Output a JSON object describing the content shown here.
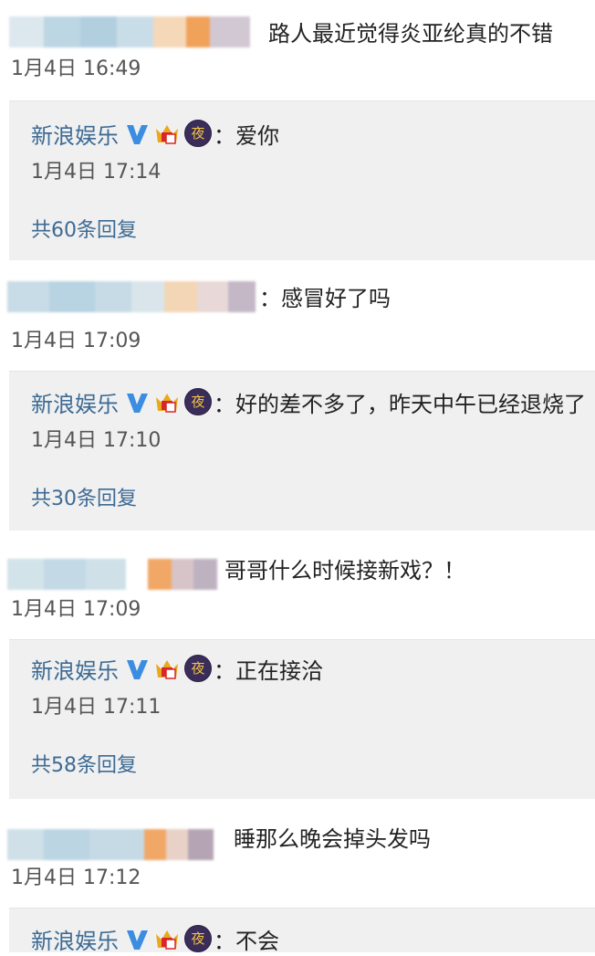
{
  "comments": [
    {
      "text": "路人最近觉得炎亚纶真的不错",
      "time": "1月4日 16:49",
      "reply": {
        "name": "新浪娱乐",
        "text": "：爱你",
        "time": "1月4日 17:14",
        "count": "共60条回复"
      }
    },
    {
      "text": "：感冒好了吗",
      "time": "1月4日 17:09",
      "reply": {
        "name": "新浪娱乐",
        "text": "：好的差不多了，昨天中午已经退烧了",
        "time": "1月4日 17:10",
        "count": "共30条回复"
      }
    },
    {
      "text": "哥哥什么时候接新戏？！",
      "time": "1月4日 17:09",
      "reply": {
        "name": "新浪娱乐",
        "text": "：正在接洽",
        "time": "1月4日 17:11",
        "count": "共58条回复"
      }
    },
    {
      "text": "睡那么晚会掉头发吗",
      "time": "1月4日 17:12",
      "reply": {
        "name": "新浪娱乐",
        "text": "：不会",
        "time": "",
        "count": ""
      }
    }
  ],
  "icons": {
    "verified": "verified-v-icon",
    "member": "crown-member-icon",
    "night": "night-badge-icon",
    "night_glyph": "夜"
  },
  "colors": {
    "link": "#3d6b94",
    "reply_bg": "#f0f0f0",
    "verified": "#3a8de0",
    "crown": "#e8a91c"
  }
}
